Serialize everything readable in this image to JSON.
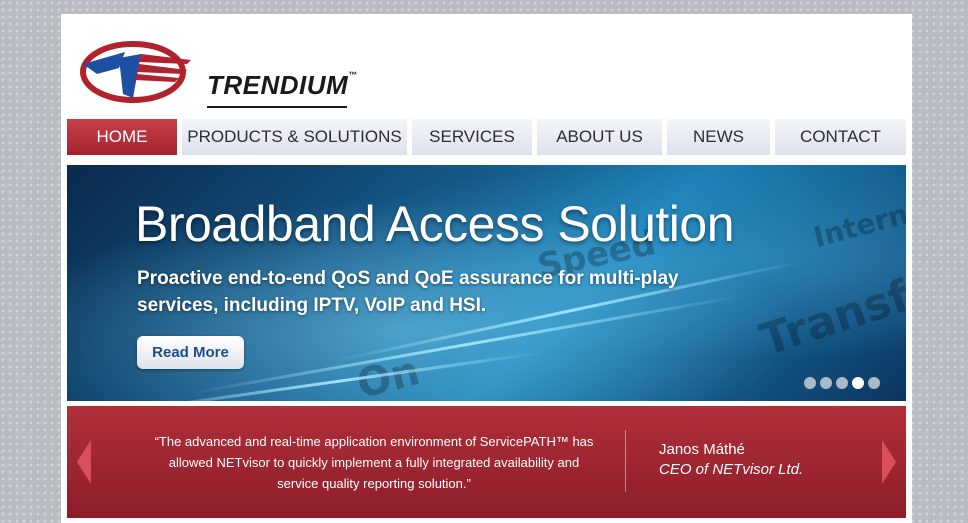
{
  "brand": {
    "name": "TRENDIUM",
    "trademark": "™"
  },
  "nav": {
    "items": [
      {
        "label": "HOME",
        "active": true
      },
      {
        "label": "PRODUCTS & SOLUTIONS",
        "active": false
      },
      {
        "label": "SERVICES",
        "active": false
      },
      {
        "label": "ABOUT US",
        "active": false
      },
      {
        "label": "NEWS",
        "active": false
      },
      {
        "label": "CONTACT",
        "active": false
      }
    ]
  },
  "hero": {
    "title": "Broadband Access Solution",
    "subtitle": "Proactive end-to-end QoS and QoE assurance for multi-play services, including IPTV, VoIP and HSI.",
    "button_label": "Read More",
    "background_words": [
      "Transfer",
      "Speed",
      "Internet",
      "On"
    ],
    "slides_total": 5,
    "slide_active": 4
  },
  "testimonial": {
    "quote": "“The advanced and real-time application environment of ServicePATH™ has allowed NETvisor to quickly implement a fully integrated availability and service quality reporting solution.”",
    "author": "Janos Máthé",
    "author_title": "CEO of NETvisor Ltd.",
    "prev_icon": "chevron-left-icon",
    "next_icon": "chevron-right-icon"
  },
  "colors": {
    "accent_red": "#a3222e",
    "nav_text": "#2a2e36",
    "hero_blue": "#155a8a",
    "button_text": "#1c4f86"
  }
}
